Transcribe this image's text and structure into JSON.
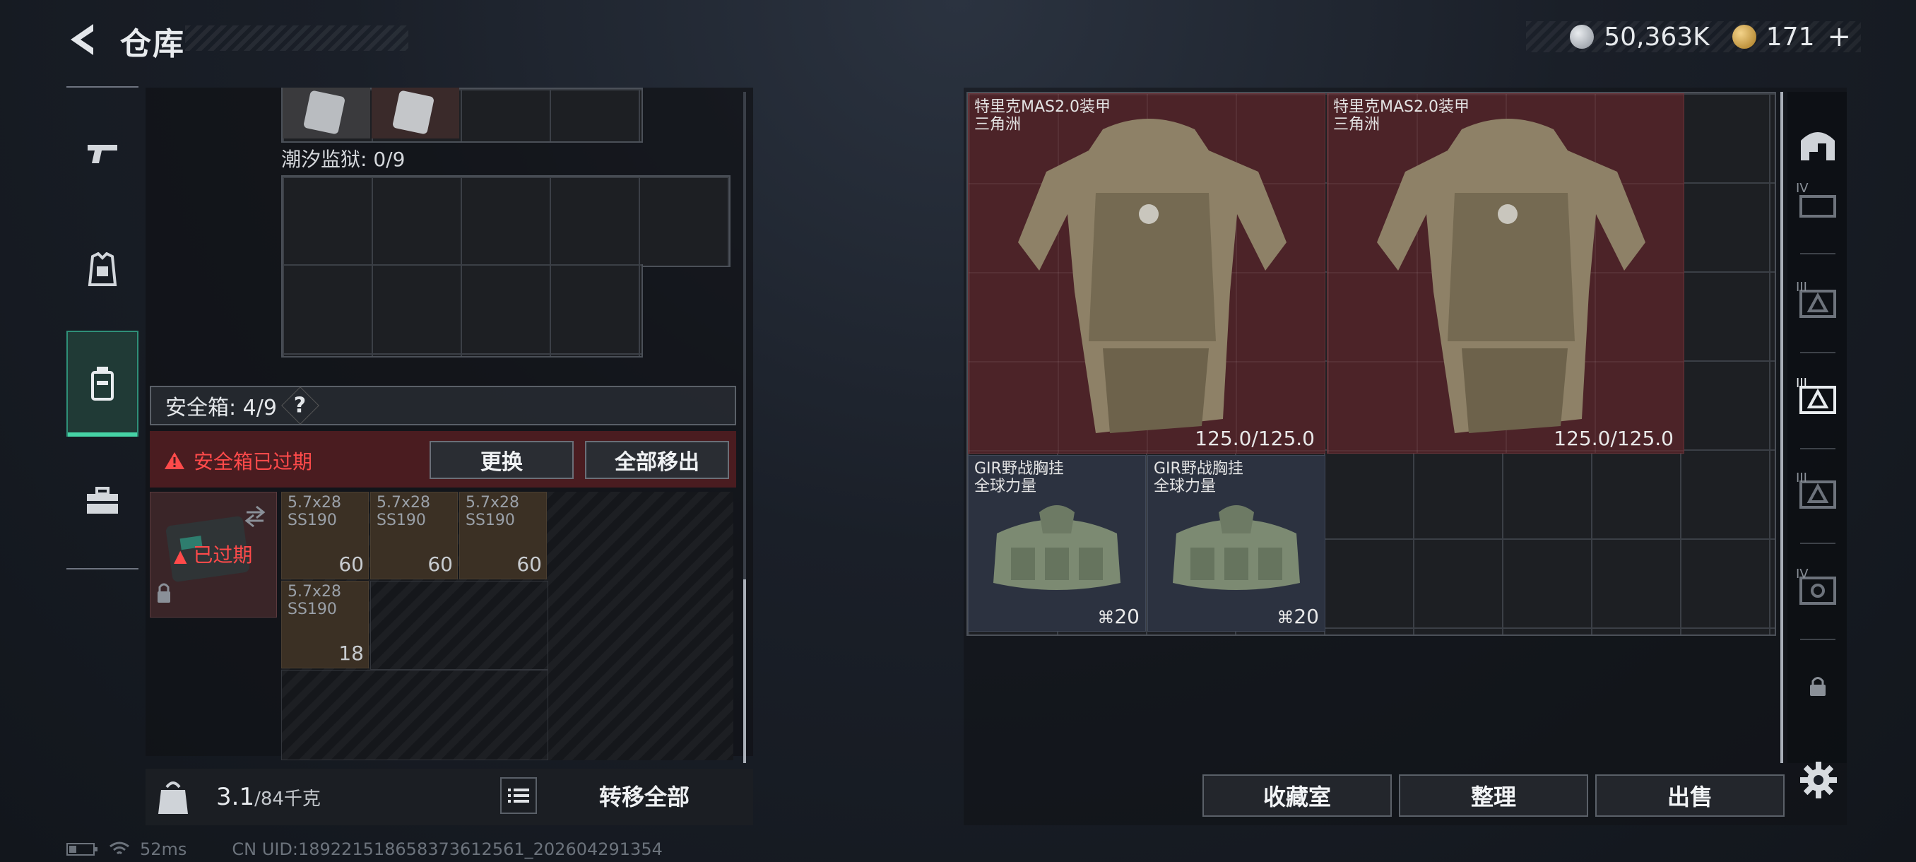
{
  "header": {
    "title": "仓库"
  },
  "currency": {
    "silver": "50,363K",
    "gold": "171",
    "plus": "+"
  },
  "containers": {
    "tidal_label": "潮汐监狱: 0/9"
  },
  "safe_box": {
    "title": "安全箱: 4/9",
    "help": "?",
    "expired_warning": "安全箱已过期",
    "replace_label": "更换",
    "remove_all_label": "全部移出",
    "expired_badge": "已过期",
    "items": [
      {
        "name_line1": "5.7x28",
        "name_line2": "SS190",
        "count": "60"
      },
      {
        "name_line1": "5.7x28",
        "name_line2": "SS190",
        "count": "60"
      },
      {
        "name_line1": "5.7x28",
        "name_line2": "SS190",
        "count": "60"
      },
      {
        "name_line1": "5.7x28",
        "name_line2": "SS190",
        "count": "18"
      }
    ]
  },
  "weight": {
    "current": "3.1",
    "max": "/84千克"
  },
  "transfer_all_label": "转移全部",
  "status": {
    "ping": "52ms",
    "uid": "CN UID:189221518658373612561_202604291354"
  },
  "stash": {
    "armors": [
      {
        "name": "特里克MAS2.0装甲",
        "sub": "三角洲",
        "durability": "125.0/125.0"
      },
      {
        "name": "特里克MAS2.0装甲",
        "sub": "三角洲",
        "durability": "125.0/125.0"
      }
    ],
    "rigs": [
      {
        "name": "GIR野战胸挂",
        "sub": "全球力量",
        "capacity": "20"
      },
      {
        "name": "GIR野战胸挂",
        "sub": "全球力量",
        "capacity": "20"
      }
    ]
  },
  "categories": {
    "tier_iv": "IV",
    "tier_iii": "III"
  },
  "bottom_buttons": {
    "collection": "收藏室",
    "organize": "整理",
    "sell": "出售"
  },
  "colors": {
    "accent": "#46d3a6",
    "danger": "#ff4a4a",
    "armor_bg": "#4c2328"
  }
}
